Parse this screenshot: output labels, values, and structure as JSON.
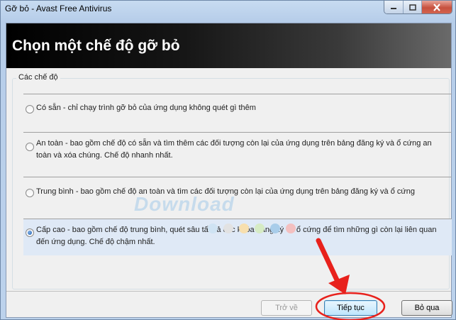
{
  "window": {
    "title": "Gỡ bỏ - Avast Free Antivirus"
  },
  "header": {
    "title": "Chọn một chế độ gỡ bỏ"
  },
  "modes": {
    "group_label": "Các chế độ",
    "options": [
      {
        "label": "Có sẵn - chỉ chạy trình gỡ bỏ của ứng dụng không quét gì thêm",
        "selected": false
      },
      {
        "label": "An toàn - bao gồm chế độ có sẵn và tìm thêm các đối tượng còn lại của ứng dụng trên bảng đăng ký và ổ cứng an toàn và xóa chúng. Chế độ nhanh nhất.",
        "selected": false
      },
      {
        "label": "Trung bình - bao gồm chế độ an toàn và tìm các đối tượng còn lại của ứng dụng trên bảng đăng ký và ổ cứng",
        "selected": false
      },
      {
        "label": "Cấp cao - bao gồm chế độ trung bình, quét sâu tất cả các khóa đăng ký và ổ cứng để tìm những gì còn lại liên quan đến ứng dụng. Chế độ chậm nhất.",
        "selected": true
      }
    ]
  },
  "watermark": {
    "text": "Download",
    "dot_colors": [
      "#cfe3f3",
      "#e2e2e2",
      "#f7dfae",
      "#d6ebc4",
      "#a9cdea",
      "#f3c0c0"
    ]
  },
  "footer": {
    "back_label": "Trở về",
    "next_label": "Tiếp tục",
    "cancel_label": "Bỏ qua"
  },
  "colors": {
    "annotation": "#e8211c"
  }
}
